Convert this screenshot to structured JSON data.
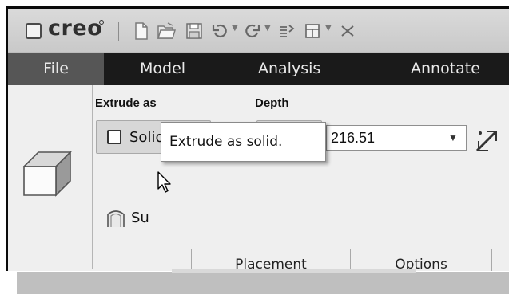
{
  "titlebar": {
    "logo_text": "creo",
    "quick_access": [
      "new-icon",
      "open-icon",
      "save-icon",
      "undo-icon",
      "redo-icon",
      "regenerate-icon",
      "windows-icon",
      "close-icon"
    ]
  },
  "tabs": [
    {
      "label": "File"
    },
    {
      "label": "Model"
    },
    {
      "label": "Analysis"
    },
    {
      "label": "Annotate"
    }
  ],
  "ribbon": {
    "extrude_as_label": "Extrude as",
    "solid_label": "Solid",
    "surface_label": "Su",
    "depth_label": "Depth",
    "depth_value": "216.51"
  },
  "tooltip": {
    "text": "Extrude as solid."
  },
  "subtabs": [
    {
      "label": "Placement"
    },
    {
      "label": "Options"
    }
  ],
  "colors": {
    "tabbar_bg": "#1a1a1a",
    "active_tab_bg": "#565656",
    "ribbon_bg": "#efefef"
  }
}
